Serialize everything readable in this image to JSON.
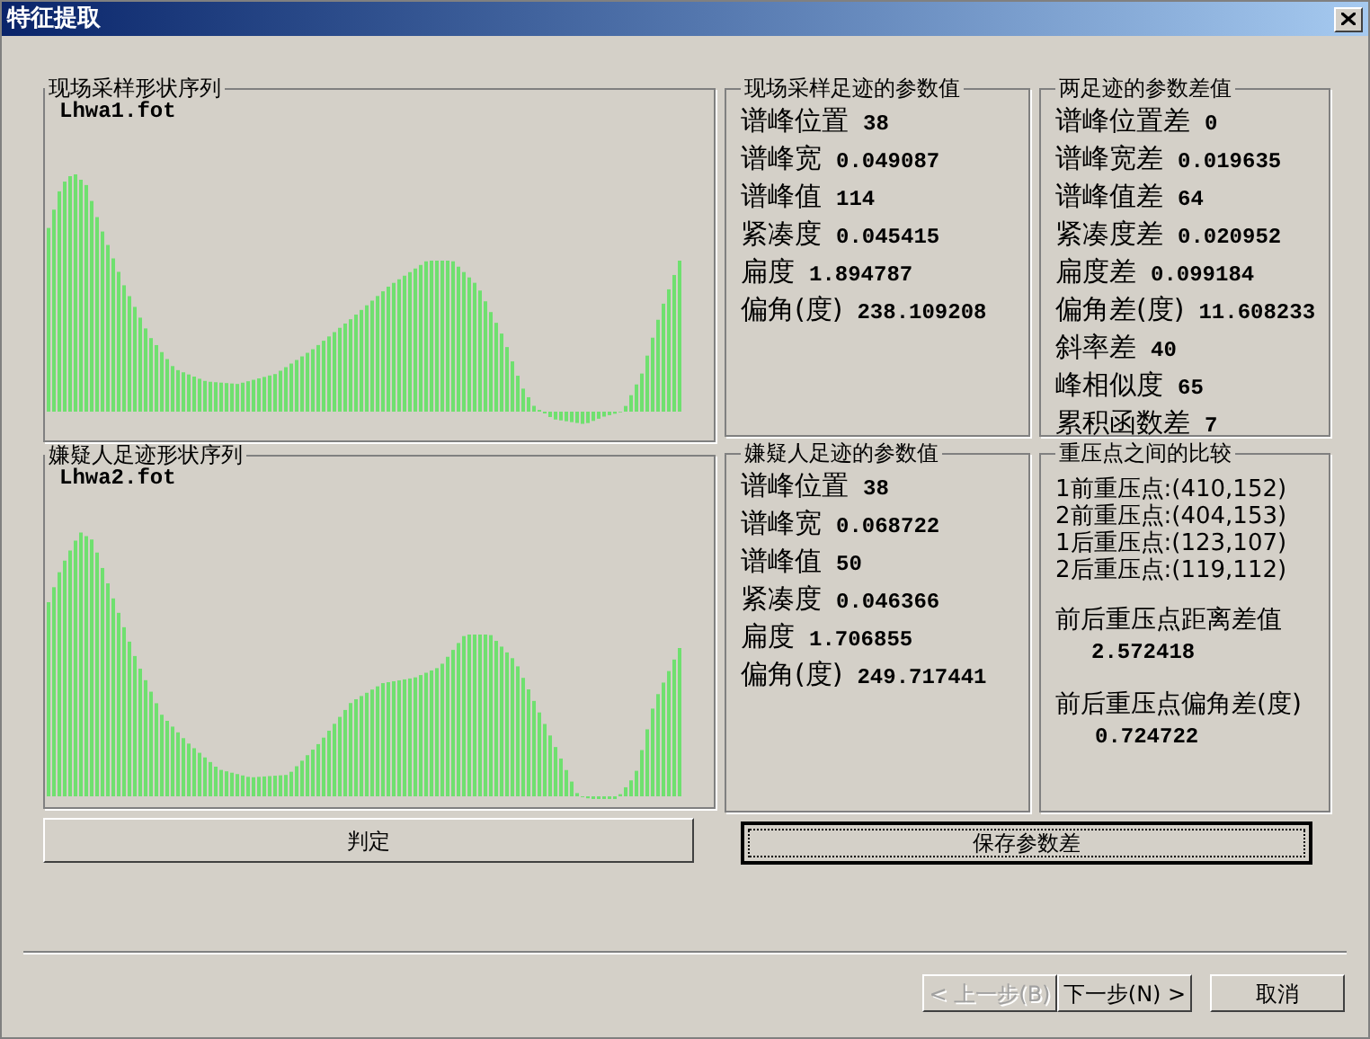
{
  "window": {
    "title": "特征提取"
  },
  "charts": [
    {
      "legend": "现场采样形状序列",
      "file": "Lhwa1.fot"
    },
    {
      "legend": "嫌疑人足迹形状序列",
      "file": "Lhwa2.fot"
    }
  ],
  "params": [
    {
      "legend": "现场采样足迹的参数值",
      "rows": [
        {
          "label": "谱峰位置",
          "value": "38"
        },
        {
          "label": "谱峰宽",
          "value": "0.049087"
        },
        {
          "label": "谱峰值",
          "value": "114"
        },
        {
          "label": "紧凑度",
          "value": "0.045415"
        },
        {
          "label": "扁度",
          "value": "1.894787"
        },
        {
          "label": "偏角(度)",
          "value": "238.109208"
        }
      ]
    },
    {
      "legend": "两足迹的参数差值",
      "rows": [
        {
          "label": "谱峰位置差",
          "value": "0"
        },
        {
          "label": "谱峰宽差",
          "value": "0.019635"
        },
        {
          "label": "谱峰值差",
          "value": "64"
        },
        {
          "label": "紧凑度差",
          "value": "0.020952"
        },
        {
          "label": "扁度差",
          "value": "0.099184"
        },
        {
          "label": "偏角差(度)",
          "value": "11.608233"
        },
        {
          "label": "斜率差",
          "value": "40"
        },
        {
          "label": "峰相似度",
          "value": "65"
        },
        {
          "label": "累积函数差",
          "value": "7"
        }
      ]
    },
    {
      "legend": "嫌疑人足迹的参数值",
      "rows": [
        {
          "label": "谱峰位置",
          "value": "38"
        },
        {
          "label": "谱峰宽",
          "value": "0.068722"
        },
        {
          "label": "谱峰值",
          "value": "50"
        },
        {
          "label": "紧凑度",
          "value": "0.046366"
        },
        {
          "label": "扁度",
          "value": "1.706855"
        },
        {
          "label": "偏角(度)",
          "value": "249.717441"
        }
      ]
    }
  ],
  "comparison": {
    "legend": "重压点之间的比较",
    "points": [
      "1前重压点:(410,152)",
      "2前重压点:(404,153)",
      "1后重压点:(123,107)",
      "2后重压点:(119,112)"
    ],
    "distance_label": "前后重压点距离差值",
    "distance_value": "2.572418",
    "angle_label": "前后重压点偏角差(度)",
    "angle_value": "0.724722"
  },
  "judge_button": {
    "label": "判定"
  },
  "save_button": {
    "label": "保存参数差",
    "focused": true
  },
  "nav_buttons": [
    {
      "label": "< 上一步(B)",
      "disabled": true
    },
    {
      "label": "下一步(N) >",
      "disabled": false
    },
    {
      "label": "取消",
      "disabled": false
    }
  ]
}
